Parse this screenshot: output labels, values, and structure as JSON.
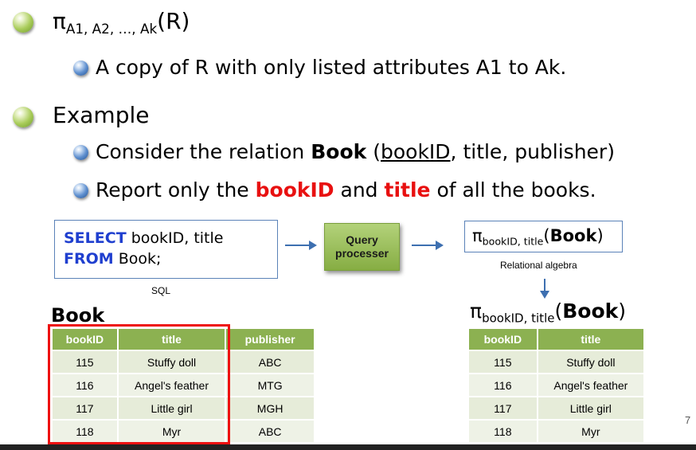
{
  "bullets": {
    "projection": {
      "symbol": "π",
      "subscript": "A1, A2, …, Ak",
      "argument": "(R)"
    },
    "projection_desc": "A copy of R with only listed attributes A1 to Ak.",
    "example": "Example",
    "consider": {
      "pre": "Consider the relation ",
      "relation": "Book",
      "open": " (",
      "key": "bookID",
      "rest": ", title, publisher)"
    },
    "report": {
      "pre": "Report only the ",
      "a": "bookID",
      "mid": " and ",
      "b": "title",
      "post": " of all the books."
    }
  },
  "sql": {
    "select_kw": "SELECT",
    "select_rest": " bookID, title",
    "from_kw": "FROM",
    "from_rest": " Book;",
    "caption": "SQL"
  },
  "processor": {
    "line1": "Query",
    "line2": "processer"
  },
  "algebra": {
    "symbol": "π",
    "subscript": "bookID, title",
    "open": "(",
    "relation": "Book",
    "close": ")",
    "caption": "Relational algebra"
  },
  "result_expr": {
    "symbol": "π",
    "subscript": "bookID, title",
    "open": "(",
    "relation": "Book",
    "close": ")"
  },
  "book_table": {
    "title": "Book",
    "columns": [
      "bookID",
      "title",
      "publisher"
    ],
    "rows": [
      [
        "115",
        "Stuffy doll",
        "ABC"
      ],
      [
        "116",
        "Angel's feather",
        "MTG"
      ],
      [
        "117",
        "Little girl",
        "MGH"
      ],
      [
        "118",
        "Myr",
        "ABC"
      ]
    ]
  },
  "result_table": {
    "columns": [
      "bookID",
      "title"
    ],
    "rows": [
      [
        "115",
        "Stuffy doll"
      ],
      [
        "116",
        "Angel's feather"
      ],
      [
        "117",
        "Little girl"
      ],
      [
        "118",
        "Myr"
      ]
    ]
  },
  "page_number": "7",
  "colors": {
    "accent_red": "#e81010",
    "keyword_blue": "#1f3fcf",
    "table_header_green": "#8cb151"
  }
}
